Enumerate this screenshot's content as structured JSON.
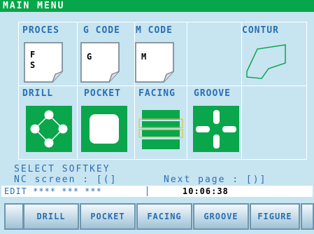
{
  "title": "MAIN MENU",
  "menu": {
    "row1": [
      {
        "label": "PROCES",
        "doc_lines": [
          "F",
          "S"
        ]
      },
      {
        "label": "G CODE",
        "doc_lines": [
          "G"
        ]
      },
      {
        "label": "M CODE",
        "doc_lines": [
          "M"
        ]
      },
      {
        "label": ""
      },
      {
        "label": "CONTUR"
      }
    ],
    "row2": [
      {
        "label": "DRILL"
      },
      {
        "label": "POCKET"
      },
      {
        "label": "FACING"
      },
      {
        "label": "GROOVE"
      },
      {
        "label": ""
      }
    ]
  },
  "messages": {
    "line1": "SELECT SOFTKEY",
    "nc_screen": "NC screen : [(]",
    "next_page": "Next page : [)]"
  },
  "status": {
    "edit": "EDIT **** *** ***",
    "clock": "10:06:38"
  },
  "softkeys": [
    "DRILL",
    "POCKET",
    "FACING",
    "GROOVE",
    "FIGURE"
  ],
  "colors": {
    "background": "#c7e4f1",
    "title_bar": "#08a64a",
    "icon_green": "#0aa64c",
    "text_blue": "#2a6fb1"
  }
}
